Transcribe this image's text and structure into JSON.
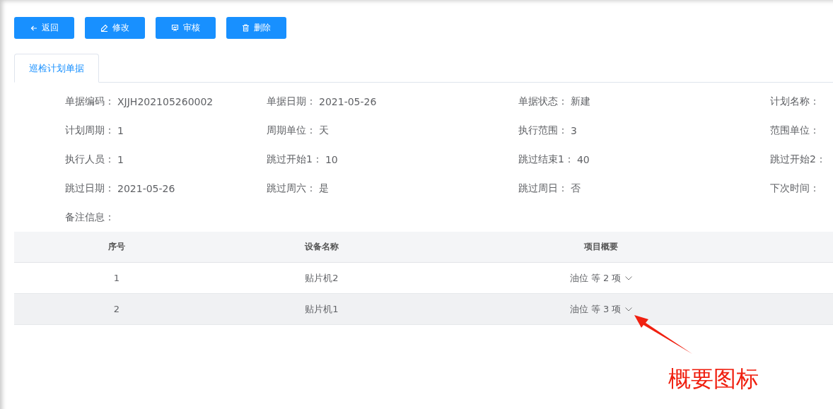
{
  "toolbar": {
    "buttons": [
      {
        "kind": "back",
        "label": "返回"
      },
      {
        "kind": "edit",
        "label": "修改"
      },
      {
        "kind": "audit",
        "label": "审核"
      },
      {
        "kind": "delete",
        "label": "删除"
      }
    ]
  },
  "tabs": [
    {
      "label": "巡检计划单据",
      "selected": true
    }
  ],
  "fields": [
    {
      "label": "单据编码：",
      "value": "XJJH202105260002"
    },
    {
      "label": "单据日期：",
      "value": "2021-05-26"
    },
    {
      "label": "单据状态：",
      "value": "新建"
    },
    {
      "label": "计划名称："
    },
    {
      "label": "计划周期：",
      "value": "1"
    },
    {
      "label": "周期单位：",
      "value": "天"
    },
    {
      "label": "执行范围：",
      "value": "3"
    },
    {
      "label": "范围单位："
    },
    {
      "label": "执行人员：",
      "value": "1"
    },
    {
      "label": "跳过开始1：",
      "value": "10"
    },
    {
      "label": "跳过结束1：",
      "value": "40"
    },
    {
      "label": "跳过开始2："
    },
    {
      "label": "跳过日期：",
      "value": "2021-05-26"
    },
    {
      "label": "跳过周六：",
      "value": "是"
    },
    {
      "label": "跳过周日：",
      "value": "否"
    },
    {
      "label": "下次时间："
    },
    {
      "label": "备注信息："
    }
  ],
  "table": {
    "columns": [
      "序号",
      "设备名称",
      "项目概要"
    ],
    "rows": [
      {
        "cells": [
          "1",
          "贴片机2",
          "油位 等 2 项"
        ],
        "highlighted": false
      },
      {
        "cells": [
          "2",
          "贴片机1",
          "油位 等 3 项"
        ],
        "highlighted": true
      }
    ]
  },
  "annotation": {
    "text": "概要图标"
  }
}
